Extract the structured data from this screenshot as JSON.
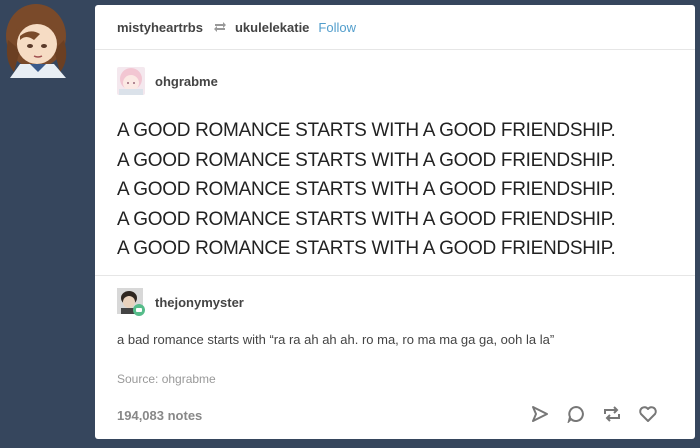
{
  "post": {
    "poster": "mistyheartrbs",
    "reblogged_from": "ukulelekatie",
    "follow_label": "Follow",
    "entries": [
      {
        "username": "ohgrabme",
        "lines": [
          "A GOOD ROMANCE STARTS WITH A GOOD FRIENDSHIP.",
          "A GOOD ROMANCE STARTS WITH A GOOD FRIENDSHIP.",
          "A GOOD ROMANCE STARTS WITH A GOOD FRIENDSHIP.",
          "A GOOD ROMANCE STARTS WITH A GOOD FRIENDSHIP.",
          "A GOOD ROMANCE STARTS WITH A GOOD FRIENDSHIP."
        ]
      },
      {
        "username": "thejonymyster",
        "text": "a bad romance starts with “ra ra ah ah ah. ro ma, ro ma ma ga ga, ooh la la”"
      }
    ],
    "source": "Source:  ohgrabme",
    "notes": "194,083 notes",
    "icons": [
      "share-icon",
      "reply-icon",
      "reblog-icon",
      "like-icon"
    ]
  },
  "colors": {
    "background": "#36465d",
    "card": "#ffffff",
    "link": "#529ecc"
  }
}
